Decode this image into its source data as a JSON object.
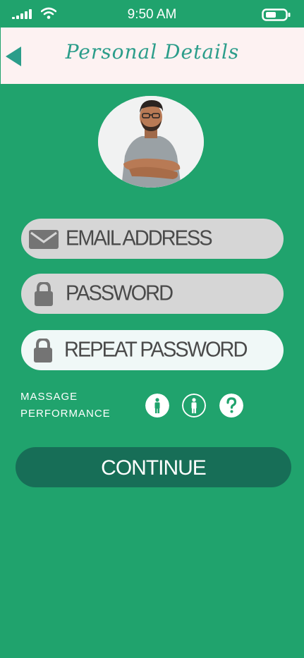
{
  "status_bar": {
    "time": "9:50 AM"
  },
  "header": {
    "title": "Personal Details"
  },
  "form": {
    "email_placeholder": "EMAIL ADDRESS",
    "password_placeholder": "PASSWORD",
    "repeat_password_placeholder": "REPEAT PASSWORD"
  },
  "massage_performance": {
    "label_line1": "MASSAGE",
    "label_line2": "PERFORMANCE",
    "options": [
      "male-icon",
      "male-outline-icon",
      "question-icon"
    ]
  },
  "continue": {
    "label": "CONTINUE"
  },
  "colors": {
    "background": "#20a36d",
    "header_bg": "#fdf2f2",
    "accent_title": "#2b9d8a",
    "button_dark": "#176e57",
    "field_gray": "#d6d6d6",
    "field_light": "#f0f8f7"
  }
}
